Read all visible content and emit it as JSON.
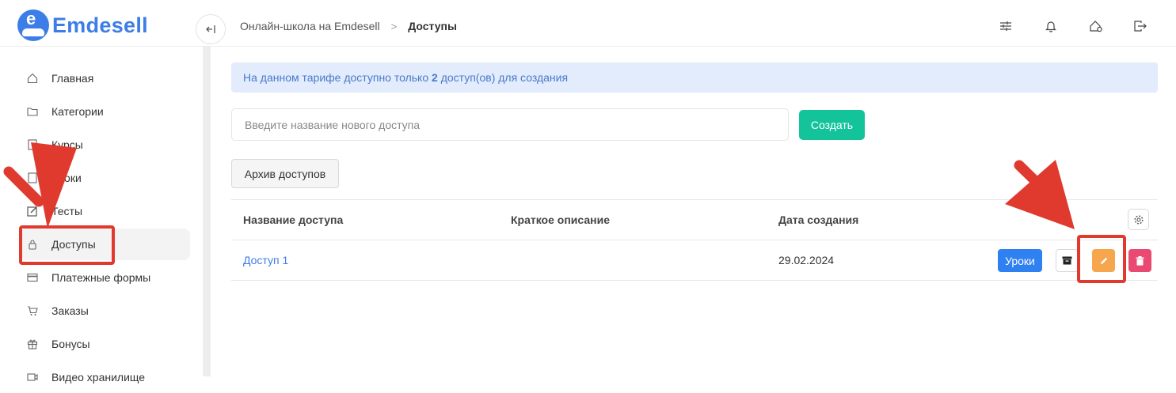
{
  "brand": {
    "name": "Emdesell",
    "mark_letter": "e",
    "color": "#3d7de8"
  },
  "breadcrumb": {
    "parent": "Онлайн-школа на Emdesell",
    "separator": ">",
    "current": "Доступы"
  },
  "header_icons": [
    "sliders-icon",
    "bell-icon",
    "home-settings-icon",
    "logout-icon"
  ],
  "sidebar": {
    "items": [
      {
        "label": "Главная",
        "icon": "home-icon"
      },
      {
        "label": "Категории",
        "icon": "folder-icon"
      },
      {
        "label": "Курсы",
        "icon": "book-icon"
      },
      {
        "label": "Уроки",
        "icon": "lesson-icon"
      },
      {
        "label": "Тесты",
        "icon": "edit-icon"
      },
      {
        "label": "Доступы",
        "icon": "lock-icon",
        "active": true
      },
      {
        "label": "Платежные формы",
        "icon": "credit-card-icon"
      },
      {
        "label": "Заказы",
        "icon": "cart-icon"
      },
      {
        "label": "Бонусы",
        "icon": "gift-icon"
      },
      {
        "label": "Видео хранилище",
        "icon": "video-icon"
      }
    ]
  },
  "alert": {
    "prefix": "На данном тарифе доступно только ",
    "count": "2",
    "suffix": " доступ(ов) для создания"
  },
  "create_form": {
    "placeholder": "Введите название нового доступа",
    "value": "",
    "button": "Создать"
  },
  "archive_button": "Архив доступов",
  "table": {
    "columns": [
      "Название доступа",
      "Краткое описание",
      "Дата создания"
    ],
    "rows": [
      {
        "name": "Доступ 1",
        "description": "",
        "created": "29.02.2024",
        "lessons_button": "Уроки"
      }
    ]
  },
  "colors": {
    "create": "#13c39a",
    "lessons": "#2f80f0",
    "edit": "#f6a74d",
    "delete": "#ea4a72",
    "alert_bg": "#e2ecfc",
    "annotation": "#e03a2f"
  }
}
